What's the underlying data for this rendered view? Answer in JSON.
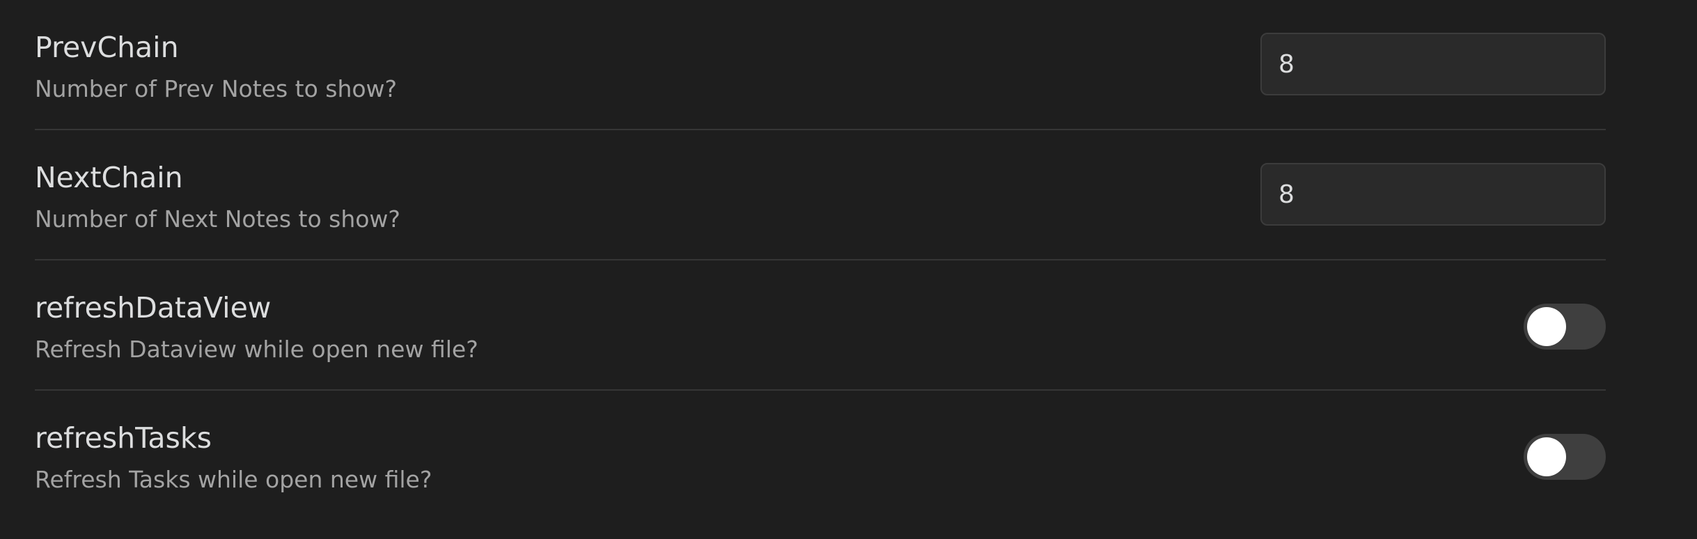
{
  "settings": [
    {
      "name": "PrevChain",
      "description": "Number of Prev Notes to show?",
      "control": "text",
      "value": "8"
    },
    {
      "name": "NextChain",
      "description": "Number of Next Notes to show?",
      "control": "text",
      "value": "8"
    },
    {
      "name": "refreshDataView",
      "description": "Refresh Dataview while open new file?",
      "control": "toggle",
      "enabled": false
    },
    {
      "name": "refreshTasks",
      "description": "Refresh Tasks while open new file?",
      "control": "toggle",
      "enabled": false
    }
  ],
  "colors": {
    "background": "#1e1e1e",
    "text_primary": "#dcddde",
    "text_muted": "#a3a3a3",
    "input_background": "#2a2a2a",
    "toggle_off": "#3f3f3f",
    "divider": "#363636"
  }
}
